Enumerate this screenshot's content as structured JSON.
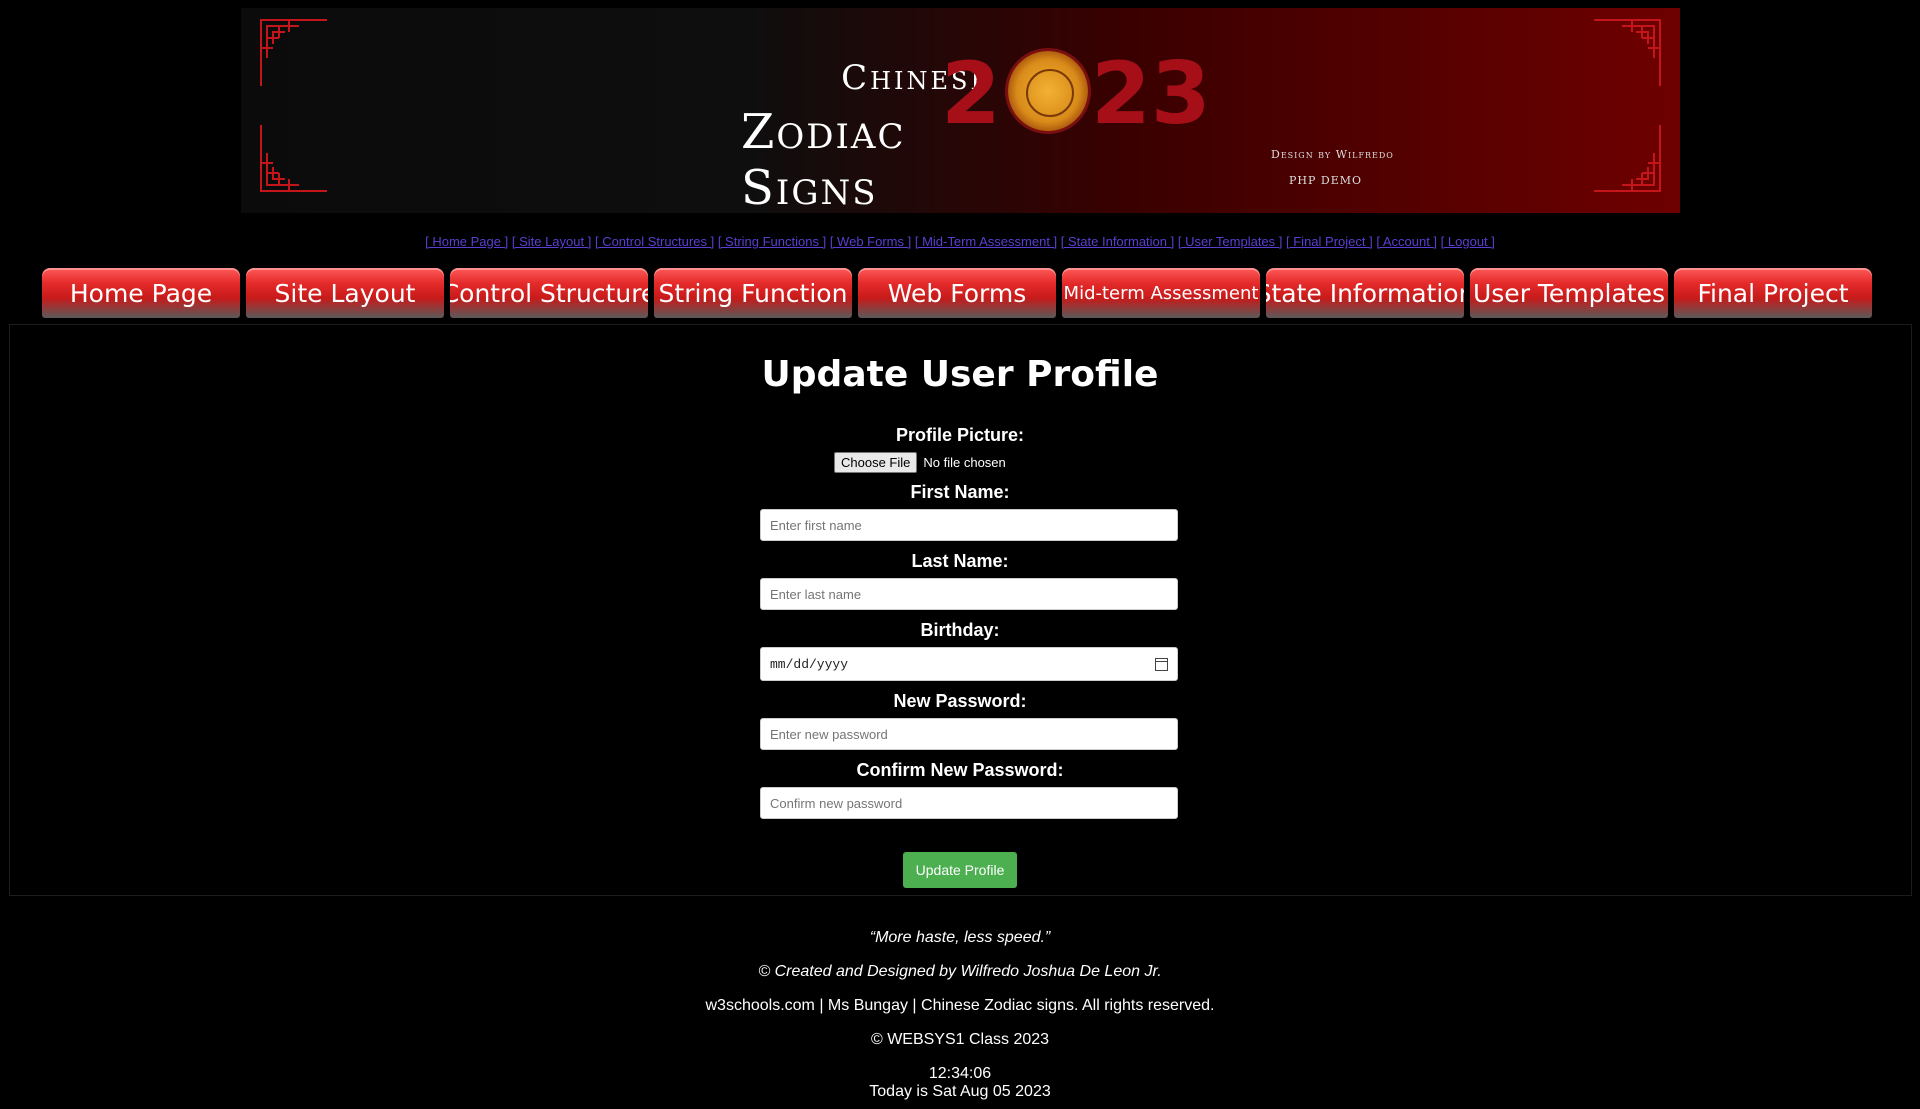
{
  "banner": {
    "title_line1": "Chinese",
    "title_line2": "Zodiac Signs",
    "year_part1": "2",
    "year_part2": "23",
    "design_by": "Design by Wilfredo",
    "php_demo": "PHP DEMO"
  },
  "text_links": [
    "[ Home Page ]",
    "[ Site Layout ]",
    "[ Control Structures ]",
    "[ String Functions ]",
    "[ Web  Forms ]",
    "[ Mid-Term Assessment ]",
    "[ State Information ]",
    "[ User Templates ]",
    "[ Final Project ]",
    "[ Account ]",
    "[ Logout ]"
  ],
  "tabs": [
    "Home Page",
    "Site Layout",
    "Control Structure",
    "String Function",
    "Web Forms",
    "Mid-term Assessment",
    "State Information",
    "User Templates",
    "Final Project"
  ],
  "form": {
    "title": "Update User Profile",
    "profile_picture_label": "Profile Picture:",
    "choose_file": "Choose File",
    "no_file": "No file chosen",
    "first_name_label": "First Name:",
    "first_name_placeholder": "Enter first name",
    "last_name_label": "Last Name:",
    "last_name_placeholder": "Enter last name",
    "birthday_label": "Birthday:",
    "birthday_value": "mm/dd/yyyy",
    "new_password_label": "New Password:",
    "new_password_placeholder": "Enter new password",
    "confirm_password_label": "Confirm New Password:",
    "confirm_password_placeholder": "Confirm new password",
    "submit": "Update Profile"
  },
  "footer": {
    "quote": "“More haste, less speed.”",
    "credit": "© Created and Designed by Wilfredo Joshua De Leon Jr.",
    "rights": "w3schools.com | Ms Bungay | Chinese Zodiac signs. All rights reserved.",
    "class": "© WEBSYS1 Class 2023",
    "time": "12:34:06",
    "date": "Today is Sat Aug 05 2023"
  },
  "colors": {
    "accent_red": "#a60f17",
    "link_purple": "#5b3fd1",
    "submit_green": "#4caf50"
  }
}
